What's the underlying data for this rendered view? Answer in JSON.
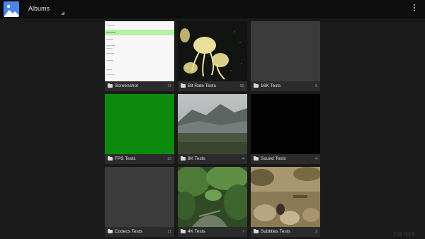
{
  "app": {
    "title": "Albums",
    "icon": "photos-app-icon",
    "accent": "#4a86e8"
  },
  "menu": {
    "icon": "overflow-menu-icon"
  },
  "albums": [
    {
      "name": "Screenshot",
      "count": "11"
    },
    {
      "name": "Bit Rate Tests",
      "count": "56"
    },
    {
      "name": "16K Tests",
      "count": "8"
    },
    {
      "name": "FPS Tests",
      "count": "13"
    },
    {
      "name": "8K Tests",
      "count": "4"
    },
    {
      "name": "Sound Tests",
      "count": "4"
    },
    {
      "name": "Codecs Tests",
      "count": "11"
    },
    {
      "name": "4K Tests",
      "count": "7"
    },
    {
      "name": "Subtitles Tests",
      "count": "2"
    }
  ],
  "watermark": "ZWIMS"
}
